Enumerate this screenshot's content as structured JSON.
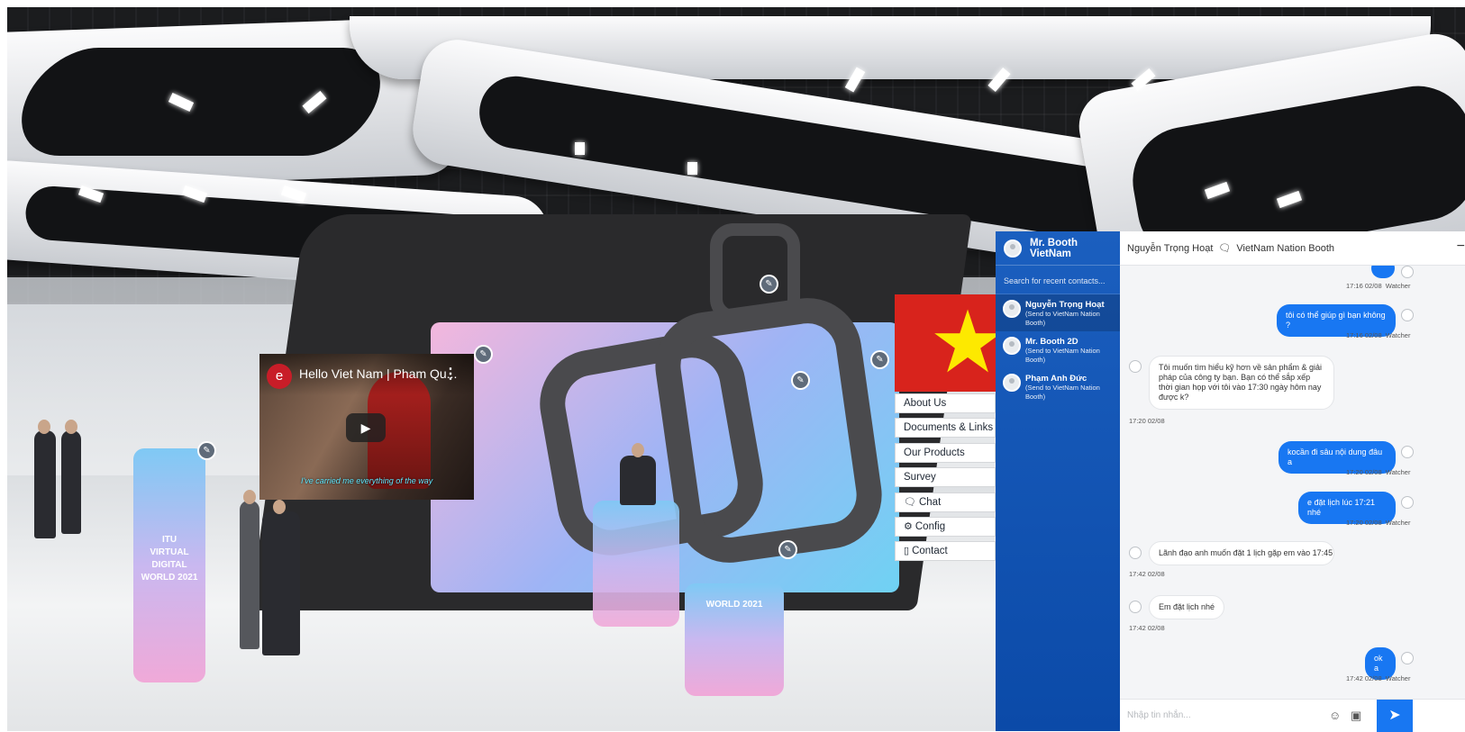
{
  "video": {
    "title": "Hello Viet Nam | Pham Qu...",
    "logo": "e",
    "subtitle": "I've carried me everything of the way"
  },
  "booth": {
    "stand_left_text": "ITU\nVIRTUAL DIGITAL\nWORLD 2021",
    "stand_center_text": "WORLD 2021",
    "menu": [
      {
        "label": "About Us",
        "icon": ""
      },
      {
        "label": "Documents & Links",
        "icon": ""
      },
      {
        "label": "Our Products",
        "icon": ""
      },
      {
        "label": "Survey",
        "icon": ""
      },
      {
        "label": "Chat",
        "icon": "chat-bubble-icon"
      },
      {
        "label": "Config",
        "icon": "gear-icon"
      },
      {
        "label": "Contact",
        "icon": "contact-card-icon"
      }
    ]
  },
  "chat": {
    "account_name": "Mr. Booth VietNam",
    "search_placeholder": "Search for recent contacts...",
    "contacts": [
      {
        "name": "Nguyễn Trọng Hoạt",
        "sub": "(Send to VietNam Nation Booth)"
      },
      {
        "name": "Mr. Booth 2D",
        "sub": "(Send to VietNam Nation Booth)"
      },
      {
        "name": "Phạm Anh Đức",
        "sub": "(Send to VietNam Nation Booth)"
      }
    ],
    "conversation_user": "Nguyễn Trọng Hoạt",
    "conversation_booth": "VietNam Nation Booth",
    "watchers_label": "Watcher",
    "messages": [
      {
        "dir": "out",
        "text": "tôi có thể giúp gì bạn không ?",
        "time": "17:16 02/08"
      },
      {
        "dir": "in",
        "text": "Tôi muốn tìm hiểu kỹ hơn về sản phẩm & giải pháp của công ty bạn. Bạn có thể sắp xếp thời gian họp với tôi vào 17:30 ngày hôm nay được k?",
        "time": "17:20 02/08"
      },
      {
        "dir": "out",
        "text": "kocần đi sâu nội dung đâu a",
        "time": "17:20 02/08"
      },
      {
        "dir": "out",
        "text": "e đặt lịch lúc 17:21 nhé",
        "time": "17:20 02/08"
      },
      {
        "dir": "in",
        "text": "Lãnh đạo anh muốn đặt 1 lịch gặp em vào 17:45",
        "time": "17:42 02/08"
      },
      {
        "dir": "in",
        "text": "Em đặt lịch nhé",
        "time": "17:42 02/08"
      },
      {
        "dir": "out",
        "text": "ok a",
        "time": "17:42 02/08"
      }
    ],
    "first_time": "17:16 02/08",
    "input_placeholder": "Nhập tin nhắn..."
  }
}
